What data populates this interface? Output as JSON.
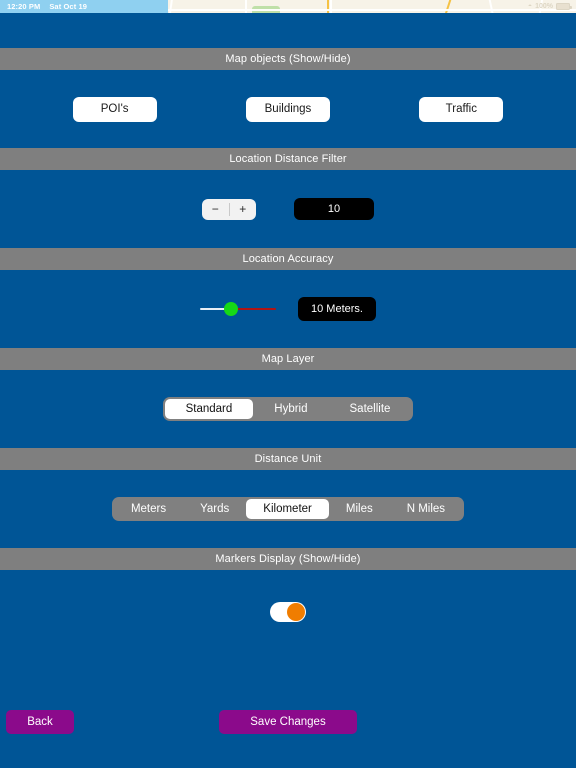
{
  "status_bar": {
    "time": "12:20 PM",
    "date": "Sat Oct 19",
    "wifi_icon": "wifi-icon",
    "battery_percent": "100%",
    "battery_icon": "battery-icon"
  },
  "sections": {
    "map_objects": {
      "header": "Map objects (Show/Hide)",
      "buttons": [
        {
          "label": "POI's"
        },
        {
          "label": "Buildings"
        },
        {
          "label": "Traffic"
        }
      ]
    },
    "location_distance_filter": {
      "header": "Location Distance Filter",
      "decrement_label": "−",
      "increment_label": "+",
      "value": "10"
    },
    "location_accuracy": {
      "header": "Location Accuracy",
      "value": "10 Meters.",
      "slider_position_percent": 40,
      "track_left_color": "#e9eef4",
      "track_right_color": "#b01515",
      "thumb_color": "#16d916"
    },
    "map_layer": {
      "header": "Map Layer",
      "options": [
        {
          "label": "Standard",
          "selected": true
        },
        {
          "label": "Hybrid",
          "selected": false
        },
        {
          "label": "Satellite",
          "selected": false
        }
      ]
    },
    "distance_unit": {
      "header": "Distance Unit",
      "options": [
        {
          "label": "Meters",
          "selected": false
        },
        {
          "label": "Yards",
          "selected": false
        },
        {
          "label": "Kilometer",
          "selected": true
        },
        {
          "label": "Miles",
          "selected": false
        },
        {
          "label": "N Miles",
          "selected": false
        }
      ]
    },
    "markers_display": {
      "header": "Markers Display (Show/Hide)",
      "toggle_on": true,
      "toggle_knob_color": "#f07d00"
    }
  },
  "footer": {
    "back_label": "Back",
    "save_label": "Save Changes",
    "button_color": "#8b0a8b"
  },
  "theme": {
    "background": "#005596",
    "header_band": "#7f7f7f"
  }
}
